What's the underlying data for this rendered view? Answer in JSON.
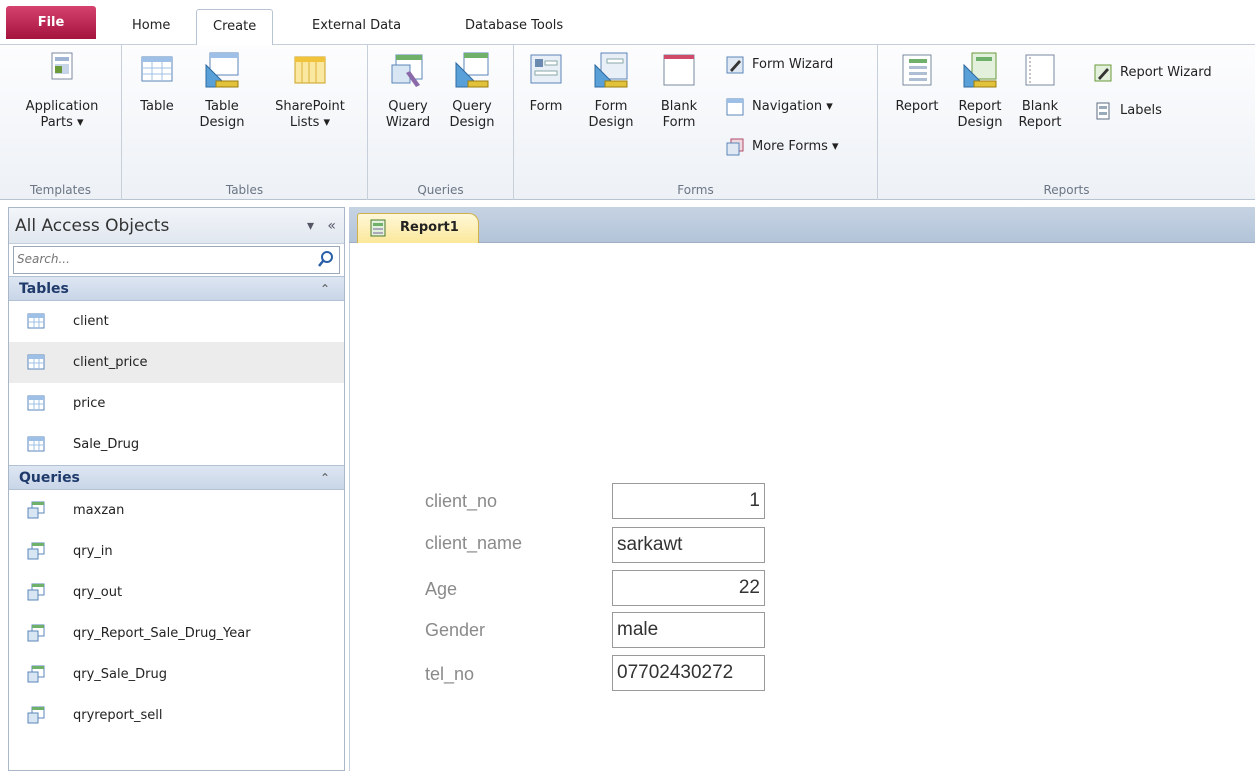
{
  "ribbon_tabs": [
    "File",
    "Home",
    "Create",
    "External Data",
    "Database Tools"
  ],
  "groups": {
    "templates": {
      "label": "Templates",
      "application_parts": [
        "Application",
        "Parts ▾"
      ]
    },
    "tables": {
      "label": "Tables",
      "table": "Table",
      "table_design": [
        "Table",
        "Design"
      ],
      "sharepoint": [
        "SharePoint",
        "Lists ▾"
      ]
    },
    "queries": {
      "label": "Queries",
      "query_wizard": [
        "Query",
        "Wizard"
      ],
      "query_design": [
        "Query",
        "Design"
      ]
    },
    "forms": {
      "label": "Forms",
      "form": "Form",
      "form_design": [
        "Form",
        "Design"
      ],
      "blank_form": [
        "Blank",
        "Form"
      ],
      "form_wizard": "Form Wizard",
      "navigation": "Navigation ▾",
      "more_forms": "More Forms ▾"
    },
    "reports": {
      "label": "Reports",
      "report": "Report",
      "report_design": [
        "Report",
        "Design"
      ],
      "blank_report": [
        "Blank",
        "Report"
      ],
      "report_wizard": "Report Wizard",
      "labels": "Labels"
    }
  },
  "nav": {
    "title": "All Access Objects",
    "search_placeholder": "Search...",
    "tables_header": "Tables",
    "tables": [
      "client",
      "client_price",
      "price",
      "Sale_Drug"
    ],
    "queries_header": "Queries",
    "queries": [
      "maxzan",
      "qry_in",
      "qry_out",
      "qry_Report_Sale_Drug_Year",
      "qry_Sale_Drug",
      "qryreport_sell"
    ]
  },
  "document": {
    "tab": "Report1",
    "fields": [
      {
        "label": "client_no",
        "value": "1",
        "align": "right"
      },
      {
        "label": "client_name",
        "value": "sarkawt",
        "align": "left"
      },
      {
        "label": "Age",
        "value": "22",
        "align": "right"
      },
      {
        "label": "Gender",
        "value": "male",
        "align": "left"
      },
      {
        "label": "tel_no",
        "value": "07702430272",
        "align": "left"
      }
    ]
  },
  "colors": {
    "file_tab": "#c0204e",
    "section_header": "#1f3a6b",
    "doc_tab": "#fbe89a"
  }
}
